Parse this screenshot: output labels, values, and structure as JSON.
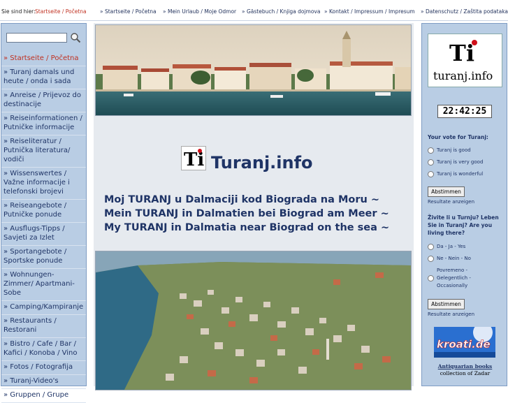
{
  "topbar": {
    "crumb_label": "Sie sind hier:",
    "crumb_link": "Startseite / Početna",
    "nav": [
      "» Startseite / Početna",
      "» Mein Urlaub / Moje Odmor",
      "» Gästebuch / Knjiga dojmova",
      "» Kontakt / Impressum / Impresum",
      "» Datenschutz / Zaštita podataka"
    ]
  },
  "sidebar": {
    "items": [
      "» Startseite / Početna",
      "» Turanj damals und heute / onda i sada",
      "» Anreise / Prijevoz do destinacije",
      "» Reiseinformationen / Putničke informacije",
      "» Reiseliteratur / Putnička literatura/ vodiči",
      "» Wissenswertes / Važne informacije i telefonski brojevi",
      "» Reiseangebote / Putničke ponude",
      "» Ausflugs-Tipps / Savjeti za Izlet",
      "» Sportangebote / Sportske ponude",
      "» Wohnungen-Zimmer/ Apartmani-Sobe",
      "» Camping/Kampiranje",
      "» Restaurants / Restorani",
      "» Bistro / Cafe / Bar / Kafici / Konoba / Vino",
      "» Fotos / Fotografija",
      "» Turanj-Video's",
      "» Gruppen / Grupe"
    ]
  },
  "main": {
    "logo_glyph": "Ti",
    "logo_text": "Turanj.info",
    "headlines": [
      "Moj TURANJ u Dalmaciji kod Biograda na Moru ~",
      "Mein TURANJ in Dalmatien bei Biograd am Meer ~",
      "My TURANJ in Dalmatia near Biograd on the sea ~"
    ]
  },
  "right": {
    "logo_glyph": "Ti",
    "logo_text": "turanj.info",
    "clock": "22:42:25",
    "poll1": {
      "question": "Your vote for Turanj:",
      "options": [
        "Turanj is good",
        "Turanj is very good",
        "Turanj is wonderful"
      ],
      "button": "Abstimmen",
      "results": "Resultate anzeigen"
    },
    "poll2": {
      "question": "Živite li u Turnju? Leben Sie in Turanj? Are you living there?",
      "options": [
        "Da - Ja - Yes",
        "Ne - Nein - No",
        "Povremeno - Gelegentlich - Occasionally"
      ],
      "button": "Abstimmen",
      "results": "Resultate anzeigen"
    },
    "banner_text": "kroati.de",
    "antiq_title": "Antiquarian books",
    "antiq_sub": "collection of Zadar"
  },
  "colors": {
    "sidebar_bg": "#b9cde4",
    "link": "#1f3466",
    "active": "#c03020",
    "main_bg": "#e6eaef"
  }
}
